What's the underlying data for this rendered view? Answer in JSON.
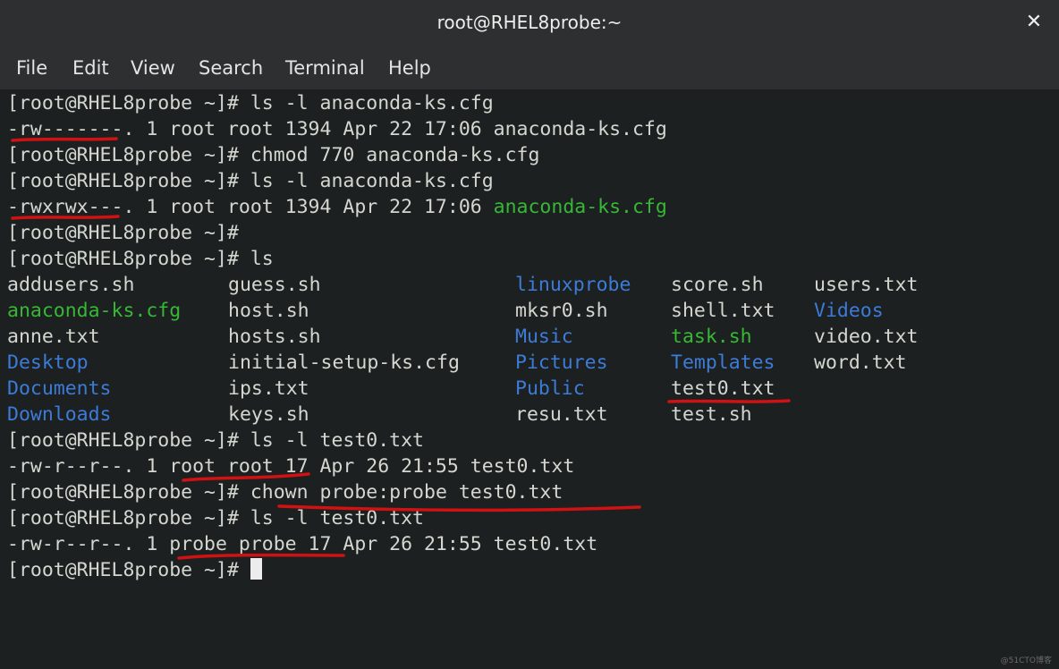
{
  "window": {
    "title": "root@RHEL8probe:~",
    "close_glyph": "✕"
  },
  "menu": [
    "File",
    "Edit",
    "View",
    "Search",
    "Terminal",
    "Help"
  ],
  "prompt": "[root@RHEL8probe ~]#",
  "lines": [
    " ls -l anaconda-ks.cfg",
    "-rw-------. 1 root root 1394 Apr 22 17:06 anaconda-ks.cfg",
    " chmod 770 anaconda-ks.cfg",
    " ls -l anaconda-ks.cfg",
    "-rwxrwx---. 1 root root 1394 Apr 22 17:06 ",
    "anaconda-ks.cfg",
    "",
    " ls",
    " ls -l test0.txt",
    "-rw-r--r--. 1 root root 17 Apr 26 21:55 test0.txt",
    " chown probe:probe test0.txt",
    " ls -l test0.txt",
    "-rw-r--r--. 1 probe probe 17 Apr 26 21:55 test0.txt"
  ],
  "listing": [
    [
      "addusers.sh",
      "guess.sh",
      "linuxprobe",
      "score.sh",
      "users.txt"
    ],
    [
      "anaconda-ks.cfg",
      "host.sh",
      "mksr0.sh",
      "shell.txt",
      "Videos"
    ],
    [
      "anne.txt",
      "hosts.sh",
      "Music",
      "task.sh",
      "video.txt"
    ],
    [
      "Desktop",
      "initial-setup-ks.cfg",
      "Pictures",
      "Templates",
      "word.txt"
    ],
    [
      "Documents",
      "ips.txt",
      "Public",
      "test0.txt"
    ],
    [
      "Downloads",
      "keys.sh",
      "resu.txt",
      "test.sh"
    ]
  ],
  "colors": {
    "terminal_bg": "#1c2021",
    "text": "#d3d7cf",
    "directory": "#3d7bd8",
    "executable": "#37b835",
    "annotation": "#d11212",
    "titlebar": "#2d2f31"
  },
  "watermark": "@51CTO博客"
}
